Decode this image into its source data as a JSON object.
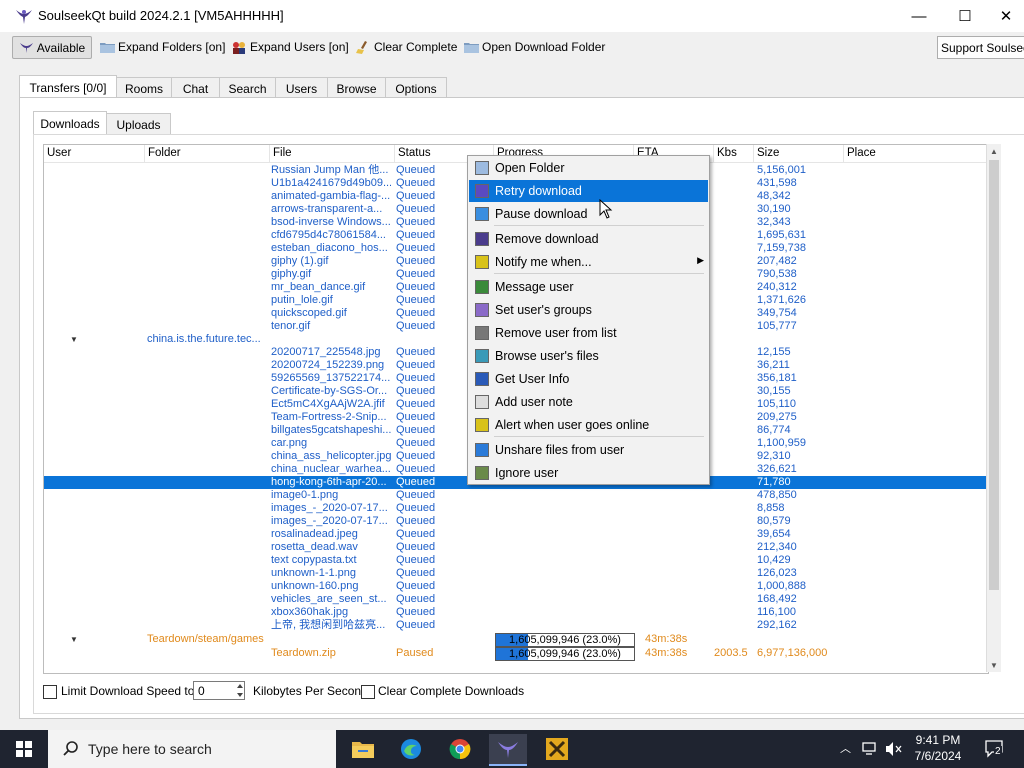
{
  "window": {
    "title": "SoulseekQt build 2024.2.1 [VM5AHHHHH]",
    "minimize_glyph": "—",
    "maximize_glyph": "☐",
    "close_glyph": "✕"
  },
  "toolbar": {
    "available_label": "Available",
    "expand_folders_label": "Expand Folders [on]",
    "expand_users_label": "Expand Users [on]",
    "clear_complete_label": "Clear Complete",
    "open_download_folder_label": "Open Download Folder",
    "support_label": "Support Soulseek"
  },
  "main_tabs": [
    "Transfers [0/0]",
    "Rooms",
    "Chat",
    "Search",
    "Users",
    "Browse",
    "Options"
  ],
  "sub_tabs": [
    "Downloads",
    "Uploads"
  ],
  "columns": [
    "User",
    "Folder",
    "File",
    "Status",
    "Progress",
    "ETA",
    "Kbs",
    "Size",
    "Place"
  ],
  "folders": [
    "china.is.the.future.tec...",
    "Teardown/steam/games"
  ],
  "rows": [
    {
      "file": "Russian Jump Man 他...",
      "status": "Queued",
      "size": "5,156,001"
    },
    {
      "file": "U1b1a4241679d49b09...",
      "status": "Queued",
      "size": "431,598"
    },
    {
      "file": "animated-gambia-flag-...",
      "status": "Queued",
      "size": "48,342"
    },
    {
      "file": "arrows-transparent-a...",
      "status": "Queued",
      "size": "30,190"
    },
    {
      "file": "bsod-inverse Windows...",
      "status": "Queued",
      "size": "32,343"
    },
    {
      "file": "cfd6795d4c78061584...",
      "status": "Queued",
      "size": "1,695,631"
    },
    {
      "file": "esteban_diacono_hos...",
      "status": "Queued",
      "size": "7,159,738"
    },
    {
      "file": "giphy (1).gif",
      "status": "Queued",
      "size": "207,482"
    },
    {
      "file": "giphy.gif",
      "status": "Queued",
      "size": "790,538"
    },
    {
      "file": "mr_bean_dance.gif",
      "status": "Queued",
      "size": "240,312"
    },
    {
      "file": "putin_lole.gif",
      "status": "Queued",
      "size": "1,371,626"
    },
    {
      "file": "quickscoped.gif",
      "status": "Queued",
      "size": "349,754"
    },
    {
      "file": "tenor.gif",
      "status": "Queued",
      "size": "105,777"
    },
    {
      "file": "",
      "status": "",
      "size": ""
    },
    {
      "file": "20200717_225548.jpg",
      "status": "Queued",
      "size": "12,155"
    },
    {
      "file": "20200724_152239.png",
      "status": "Queued",
      "size": "36,211"
    },
    {
      "file": "59265569_137522174...",
      "status": "Queued",
      "size": "356,181"
    },
    {
      "file": "Certificate-by-SGS-Or...",
      "status": "Queued",
      "size": "30,155"
    },
    {
      "file": "Ect5mC4XgAAjW2A.jfif",
      "status": "Queued",
      "size": "105,110"
    },
    {
      "file": "Team-Fortress-2-Snip...",
      "status": "Queued",
      "size": "209,275"
    },
    {
      "file": "billgates5gcatshapeshi...",
      "status": "Queued",
      "size": "86,774"
    },
    {
      "file": "car.png",
      "status": "Queued",
      "size": "1,100,959"
    },
    {
      "file": "china_ass_helicopter.jpg",
      "status": "Queued",
      "size": "92,310"
    },
    {
      "file": "china_nuclear_warhea...",
      "status": "Queued",
      "size": "326,621"
    },
    {
      "file": "hong-kong-6th-apr-20...",
      "status": "Queued",
      "size": "71,780"
    },
    {
      "file": "image0-1.png",
      "status": "Queued",
      "size": "478,850"
    },
    {
      "file": "images_-_2020-07-17...",
      "status": "Queued",
      "size": "8,858"
    },
    {
      "file": "images_-_2020-07-17...",
      "status": "Queued",
      "size": "80,579"
    },
    {
      "file": "rosalinadead.jpeg",
      "status": "Queued",
      "size": "39,654"
    },
    {
      "file": "rosetta_dead.wav",
      "status": "Queued",
      "size": "212,340"
    },
    {
      "file": "text copypasta.txt",
      "status": "Queued",
      "size": "10,429"
    },
    {
      "file": "unknown-1-1.png",
      "status": "Queued",
      "size": "126,023"
    },
    {
      "file": "unknown-160.png",
      "status": "Queued",
      "size": "1,000,888"
    },
    {
      "file": "vehicles_are_seen_st...",
      "status": "Queued",
      "size": "168,492"
    },
    {
      "file": "xbox360hak.jpg",
      "status": "Queued",
      "size": "116,100"
    },
    {
      "file": "上帝, 我想闲到哈兹亮...",
      "status": "Queued",
      "size": "292,162"
    }
  ],
  "teardown_folder_row": {
    "progress_text": "1,605,099,946 (23.0%)",
    "progress_fraction": 0.23,
    "eta": "43m:38s"
  },
  "teardown_file_row": {
    "file": "Teardown.zip",
    "status": "Paused",
    "progress_text": "1,605,099,946 (23.0%)",
    "progress_fraction": 0.23,
    "eta": "43m:38s",
    "kbs": "2003.5",
    "size": "6,977,136,000"
  },
  "context_menu": [
    "Open Folder",
    "Retry download",
    "Pause download",
    "Remove download",
    "Notify me when...",
    "Message user",
    "Set user's groups",
    "Remove user from list",
    "Browse user's files",
    "Get User Info",
    "Add user note",
    "Alert when user goes online",
    "Unshare files from user",
    "Ignore user"
  ],
  "bottom": {
    "limit_label": "Limit Download Speed to",
    "speed_value": "0",
    "units_label": "Kilobytes Per Second",
    "clear_label": "Clear Complete Downloads"
  },
  "taskbar": {
    "search_placeholder": "Type here to search",
    "time": "9:41 PM",
    "date": "7/6/2024",
    "notification_count": "2"
  },
  "colors": {
    "accent": "#0a74d8",
    "queued_text": "#1f5fc8",
    "paused_text": "#e08a1c"
  }
}
